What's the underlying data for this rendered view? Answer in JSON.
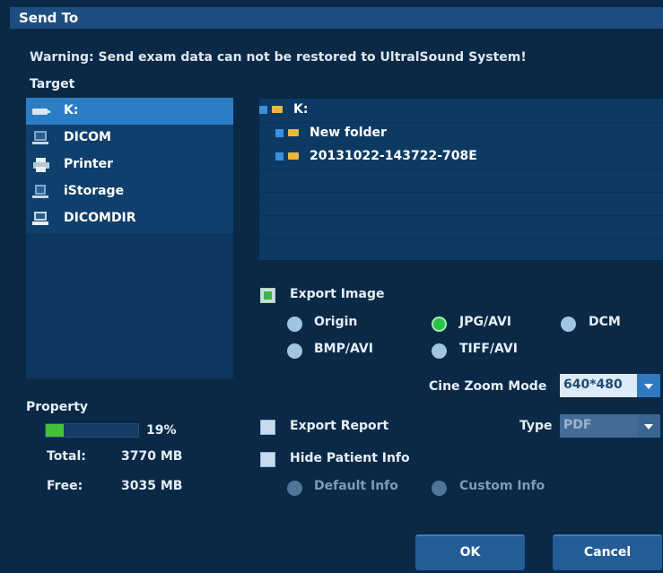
{
  "title": "Send To",
  "warning": "Warning: Send exam data can not be restored to UltralSound System!",
  "target_label": "Target",
  "targets": [
    {
      "label": "K:",
      "icon": "drive-icon"
    },
    {
      "label": "DICOM",
      "icon": "dicom-icon"
    },
    {
      "label": "Printer",
      "icon": "printer-icon"
    },
    {
      "label": "iStorage",
      "icon": "istorage-icon"
    },
    {
      "label": "DICOMDIR",
      "icon": "dicomdir-icon"
    }
  ],
  "tree": [
    {
      "label": "K:"
    },
    {
      "label": "New folder"
    },
    {
      "label": "20131022-143722-708E"
    }
  ],
  "export_image": {
    "label": "Export Image",
    "checked": true,
    "options": [
      "Origin",
      "JPG/AVI",
      "DCM",
      "BMP/AVI",
      "TIFF/AVI"
    ],
    "selected": "JPG/AVI"
  },
  "cine_zoom": {
    "label": "Cine Zoom Mode",
    "value": "640*480"
  },
  "export_report": {
    "label": "Export Report",
    "checked": false
  },
  "type": {
    "label": "Type",
    "value": "PDF"
  },
  "hide_patient": {
    "label": "Hide Patient Info",
    "checked": false,
    "options": [
      "Default Info",
      "Custom Info"
    ]
  },
  "property": {
    "label": "Property",
    "usage_percent": 19,
    "usage_text": "19%",
    "total_label": "Total:",
    "total_value": "3770 MB",
    "free_label": "Free:",
    "free_value": "3035 MB"
  },
  "buttons": {
    "ok": "OK",
    "cancel": "Cancel"
  },
  "colors": {
    "accent": "#2b7ec6",
    "background": "#0a2946",
    "progress": "#45c039"
  }
}
